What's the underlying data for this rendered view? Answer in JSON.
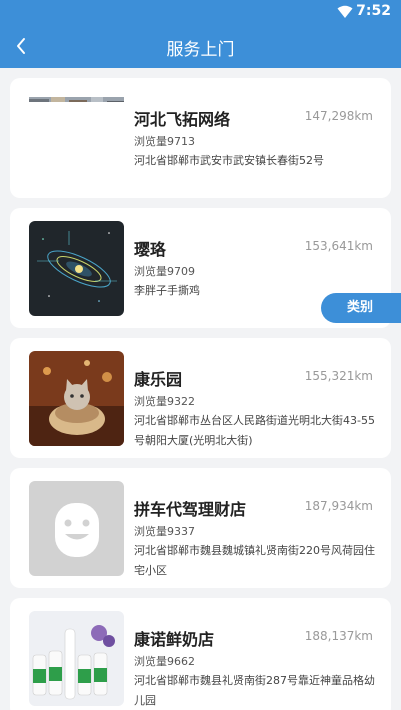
{
  "status": {
    "time": "7:52",
    "wifi_icon": "wifi-icon"
  },
  "nav": {
    "title": "服务上门",
    "back_icon": "chevron-left-icon"
  },
  "category_button": "类别",
  "services": [
    {
      "name": "河北飞拓网络",
      "distance": "147,298km",
      "views": "浏览量9713",
      "address": "河北省邯郸市武安市武安镇长春街52号",
      "image": "photo-thumbnail"
    },
    {
      "name": "璎珞",
      "distance": "153,641km",
      "views": "浏览量9709",
      "address": "李胖子手撕鸡",
      "image": "galaxy-thumbnail"
    },
    {
      "name": "康乐园",
      "distance": "155,321km",
      "views": "浏览量9322",
      "address": "河北省邯郸市丛台区人民路街道光明北大街43-55号朝阳大厦(光明北大街)",
      "image": "kitten-thumbnail"
    },
    {
      "name": "拼车代驾理财店",
      "distance": "187,934km",
      "views": "浏览量9337",
      "address": "河北省邯郸市魏县魏城镇礼贤南街220号风荷园住宅小区",
      "image": "placeholder-face-thumbnail"
    },
    {
      "name": "康诺鲜奶店",
      "distance": "188,137km",
      "views": "浏览量9662",
      "address": "河北省邯郸市魏县礼贤南街287号靠近神童品格幼儿园",
      "image": "milk-bottles-thumbnail"
    }
  ]
}
